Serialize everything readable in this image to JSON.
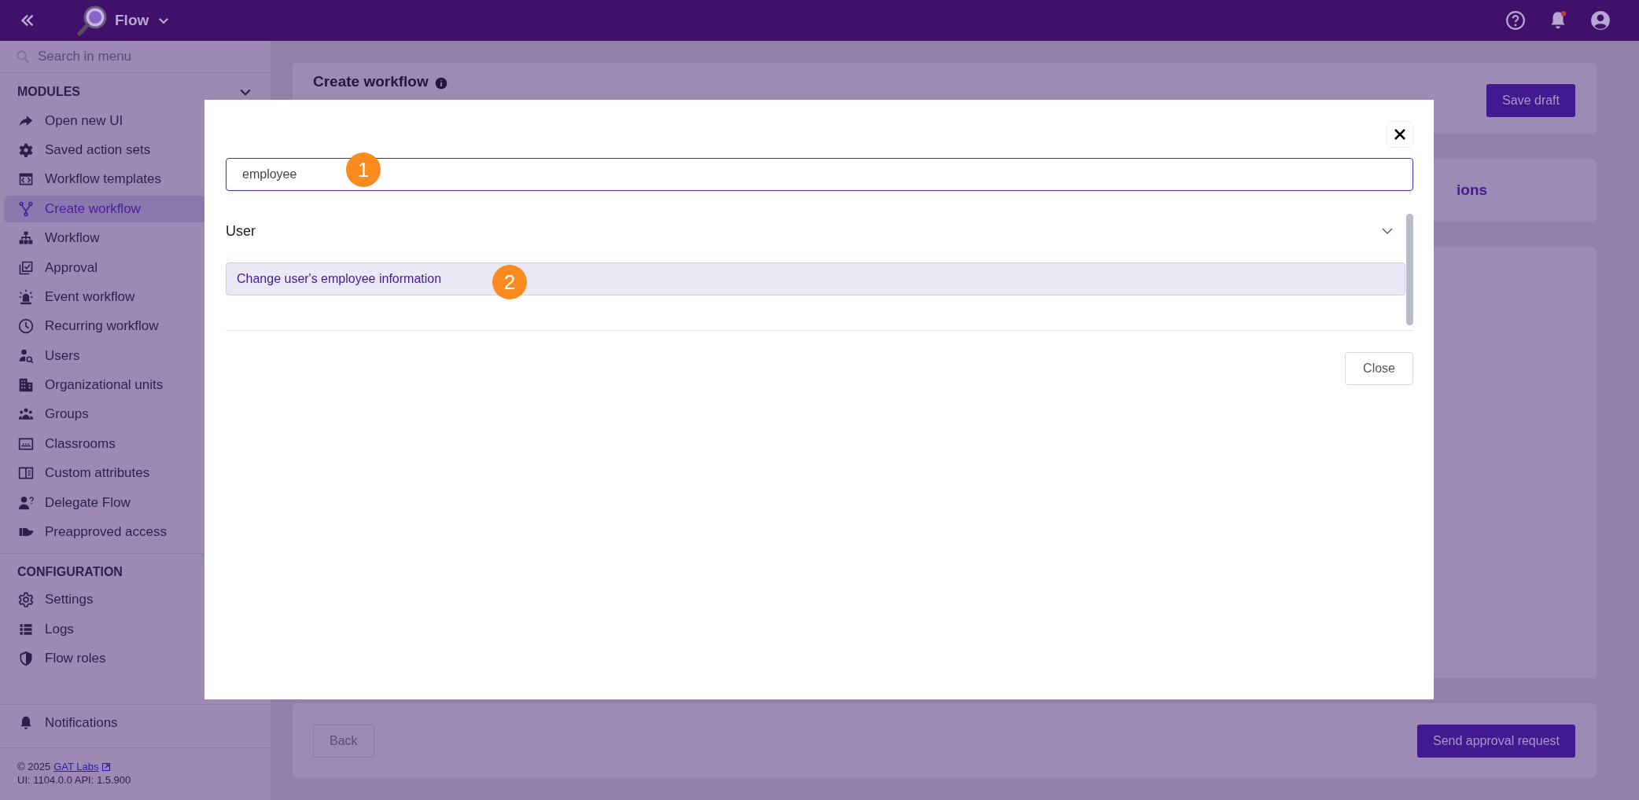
{
  "topbar": {
    "app_name": "Flow"
  },
  "sidebar": {
    "search": {
      "placeholder": "Search in menu"
    },
    "sections": [
      {
        "title": "MODULES",
        "expanded": true,
        "items": [
          {
            "label": "Open new UI",
            "selected": false
          },
          {
            "label": "Saved action sets",
            "selected": false
          },
          {
            "label": "Workflow templates",
            "selected": false
          },
          {
            "label": "Create workflow",
            "selected": true
          },
          {
            "label": "Workflow",
            "selected": false
          },
          {
            "label": "Approval",
            "selected": false
          },
          {
            "label": "Event workflow",
            "selected": false
          },
          {
            "label": "Recurring workflow",
            "selected": false
          },
          {
            "label": "Users",
            "selected": false
          },
          {
            "label": "Organizational units",
            "selected": false
          },
          {
            "label": "Groups",
            "selected": false
          },
          {
            "label": "Classrooms",
            "selected": false
          },
          {
            "label": "Custom attributes",
            "selected": false
          },
          {
            "label": "Delegate Flow",
            "selected": false
          },
          {
            "label": "Preapproved access",
            "selected": false
          }
        ]
      },
      {
        "title": "CONFIGURATION",
        "items": [
          {
            "label": "Settings",
            "selected": false
          },
          {
            "label": "Logs",
            "selected": false
          },
          {
            "label": "Flow roles",
            "selected": false
          }
        ]
      }
    ],
    "notifications": "Notifications",
    "footer": {
      "copyright": "© 2025",
      "link": "GAT Labs",
      "version": "UI: 1104.0.0 API: 1.5.900"
    }
  },
  "page": {
    "title": "Create workflow",
    "save_button": "Save draft",
    "section_title": "ions",
    "back_button": "Back",
    "send_button": "Send approval request"
  },
  "dialog": {
    "search": {
      "value": "employee"
    },
    "groups": [
      {
        "title": "User",
        "expanded": true,
        "items": [
          {
            "label": "Change user's employee information",
            "selected": true
          }
        ]
      }
    ],
    "close_button": "Close"
  },
  "annotations": [
    {
      "number": "1"
    },
    {
      "number": "2"
    }
  ]
}
